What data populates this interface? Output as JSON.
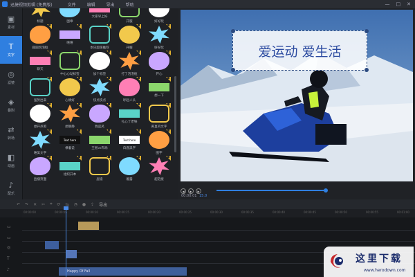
{
  "titlebar": {
    "app_title": "迅捷视频剪辑 (免费版)",
    "menus": [
      "文件",
      "编辑",
      "导出",
      "帮助"
    ],
    "win_controls": [
      "—",
      "□",
      "✕"
    ]
  },
  "sidebar": {
    "items": [
      {
        "label": "素材",
        "icon": "film-icon"
      },
      {
        "label": "文字",
        "icon": "text-icon",
        "active": true
      },
      {
        "label": "滤镜",
        "icon": "filter-icon"
      },
      {
        "label": "叠附",
        "icon": "layers-icon"
      },
      {
        "label": "转场",
        "icon": "transition-icon"
      },
      {
        "label": "动画",
        "icon": "animation-icon"
      },
      {
        "label": "配乐",
        "icon": "music-icon"
      }
    ]
  },
  "library": {
    "rows": [
      [
        "标题",
        "图章",
        "大家早上好",
        "开服",
        "好好玩"
      ],
      [
        "圆圆泡泡框",
        "嘻嘻",
        "本日超值推荐",
        "开服",
        "好好玩"
      ],
      [
        "聊天",
        "中心心动标签",
        "加个标签",
        "打了泡泡框",
        "开心"
      ],
      [
        "强势出来",
        "心情好",
        "快点快点",
        "呼起人头",
        "想一下"
      ],
      [
        "想开点吧",
        "想静静",
        "我是风",
        "扎心了老铁",
        "黄直的文字"
      ],
      [
        "唯美文字",
        "横着说",
        "王者vs布局",
        "白底黑字",
        "图字"
      ],
      [
        "直播页面",
        "组织开本",
        "层级",
        "着露",
        "超链接"
      ]
    ],
    "text_here": "Text here"
  },
  "video": {
    "caption": "爱运动 爱生活"
  },
  "controls": {
    "timecode": "00:00:01",
    "total": "15.0"
  },
  "toolbar": {
    "export_label": "导出"
  },
  "ruler": {
    "ticks": [
      "00:00:00",
      "00:00:05",
      "00:00:10",
      "00:00:15",
      "00:00:20",
      "00:00:25",
      "00:00:30",
      "00:00:35",
      "00:00:40",
      "00:00:45",
      "00:00:50",
      "00:00:55",
      "00:01:00"
    ]
  },
  "timeline": {
    "text_clip": "Happy Of Fall"
  },
  "watermark": {
    "title": "这里下载",
    "url": "www.herodown.com"
  }
}
